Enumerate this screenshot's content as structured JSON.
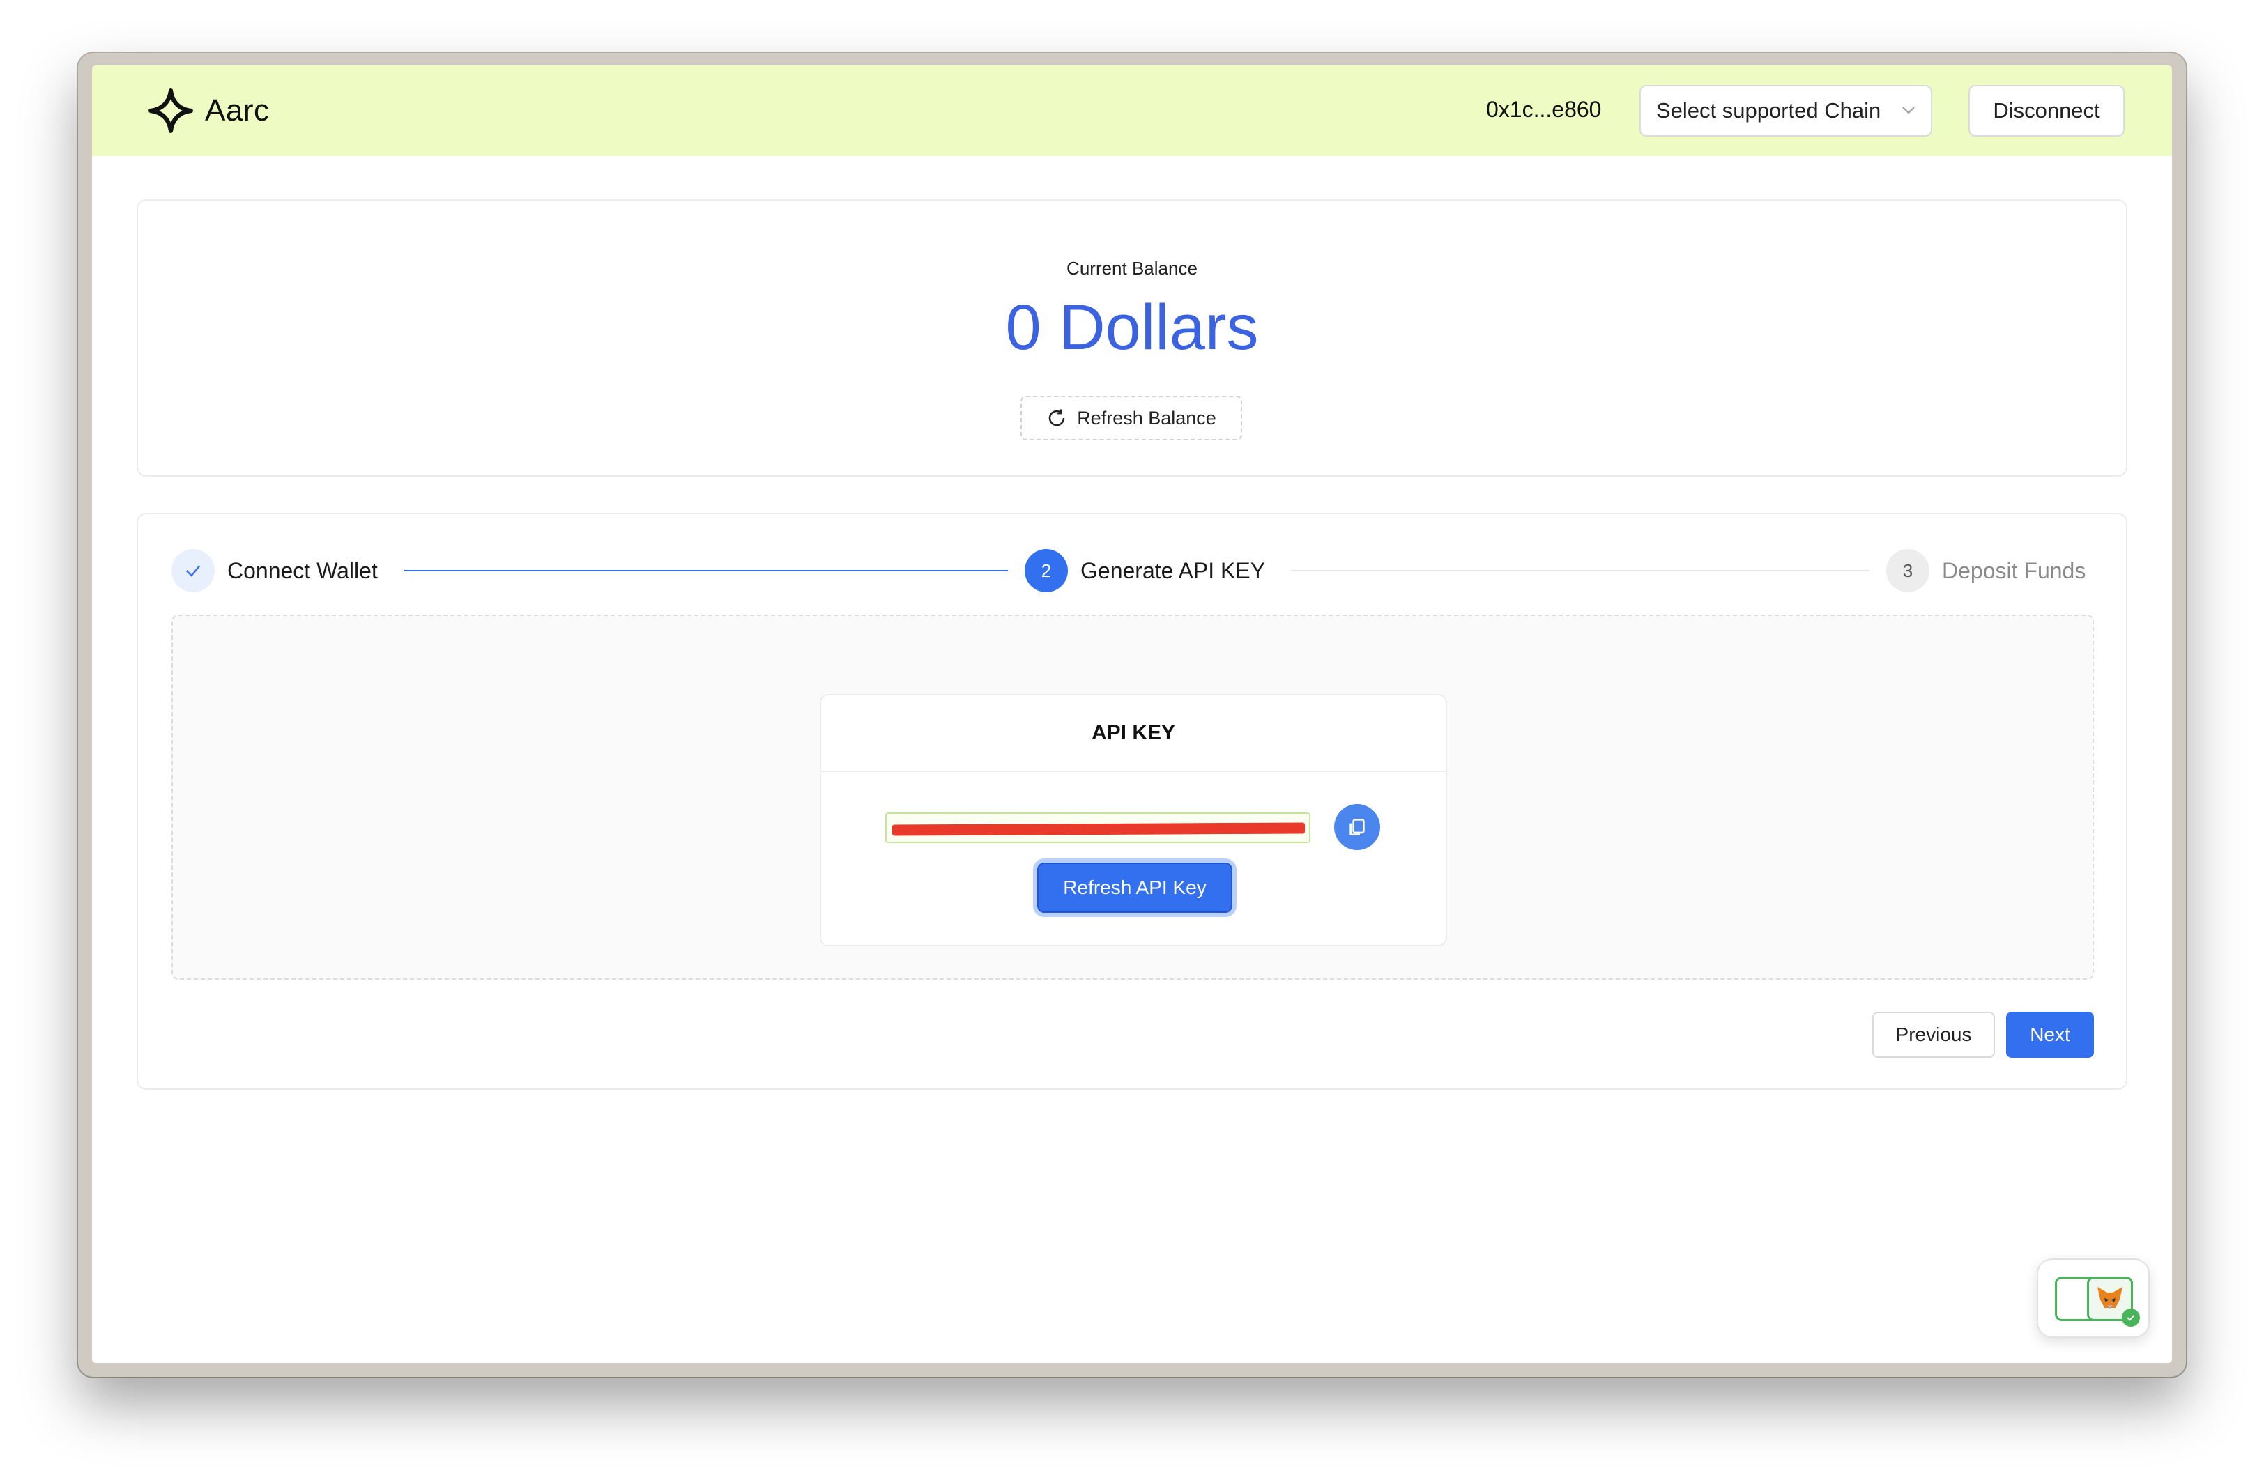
{
  "header": {
    "logo_text": "Aarc",
    "address": "0x1c...e860",
    "chain_select": "Select supported Chain",
    "disconnect_label": "Disconnect"
  },
  "balance": {
    "label": "Current Balance",
    "amount": "0 Dollars",
    "refresh_label": "Refresh Balance",
    "accent_color": "#3b62e0"
  },
  "stepper": {
    "steps": [
      {
        "number": "1",
        "label": "Connect Wallet",
        "status": "done"
      },
      {
        "number": "2",
        "label": "Generate API KEY",
        "status": "active"
      },
      {
        "number": "3",
        "label": "Deposit Funds",
        "status": "pending"
      }
    ]
  },
  "api_card": {
    "title": "API KEY",
    "refresh_label": "Refresh API Key",
    "copy_icon": "copy-icon"
  },
  "navigation": {
    "previous_label": "Previous",
    "next_label": "Next"
  },
  "colors": {
    "primary": "#3370f0",
    "header_bg": "#eefcc3",
    "redaction": "#e8392b"
  }
}
